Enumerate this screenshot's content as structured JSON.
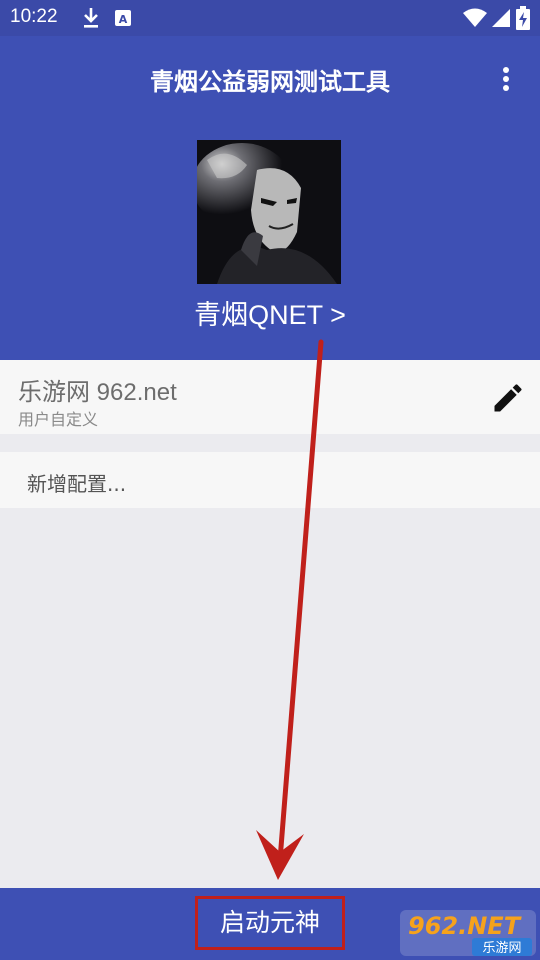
{
  "status_bar": {
    "time": "10:22",
    "icons": [
      "download-icon",
      "keyboard-a-icon",
      "wifi-icon",
      "signal-icon",
      "battery-charging-icon"
    ]
  },
  "header": {
    "title": "青烟公益弱网测试工具",
    "profile_link": "青烟QNET >"
  },
  "config_list": [
    {
      "name": "乐游网 962.net",
      "subtitle": "用户自定义"
    }
  ],
  "add_config_label": "新增配置...",
  "bottom_bar": {
    "launch_label": "启动元神"
  },
  "watermark": {
    "brand": "962.NET",
    "sub": "乐游网"
  },
  "colors": {
    "primary": "#3e50b4",
    "status_bar": "#3b4aa8",
    "annotation_red": "#c0201b"
  }
}
